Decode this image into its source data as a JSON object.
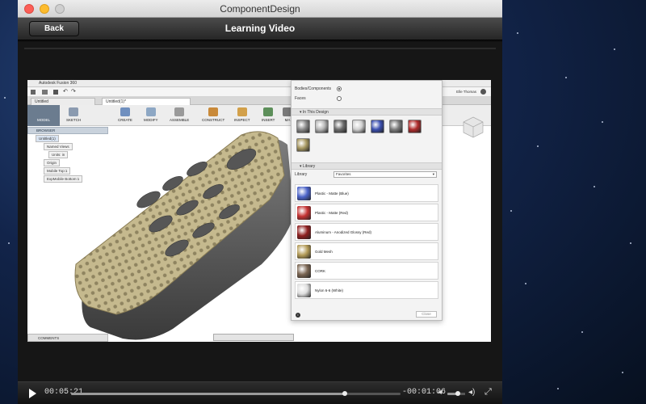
{
  "window": {
    "title": "ComponentDesign",
    "back_label": "Back",
    "page_title": "Learning Video"
  },
  "fusion": {
    "app_title": "Autodesk Fusion 360",
    "tabs": [
      "Untitled",
      "Untitled(1)*"
    ],
    "user": "Elle Thomas",
    "model_label": "MODEL",
    "ribbon": [
      "SKETCH",
      "CREATE",
      "MODIFY",
      "ASSEMBLE",
      "CONSTRUCT",
      "INSPECT",
      "INSERT",
      "MA"
    ],
    "browser": {
      "header": "BROWSER",
      "root": "Untitled(1)",
      "items": [
        "Named Views",
        "Units: in",
        "Origin",
        "Mobile Top:1",
        "ExpMobile Bottom:1"
      ]
    },
    "comments_label": "COMMENTS"
  },
  "materials": {
    "apply_to_label": "Bodies/Components",
    "faces_label": "Faces",
    "in_design_label": "In This Design",
    "design_swatches": [
      "#8a8a8a",
      "#b5b5b5",
      "#6c6c6c",
      "#cfcfcf",
      "#3b4fb0",
      "#7c7c7c",
      "#b02c2c",
      "#a99a63"
    ],
    "library_section": "Library",
    "library_label": "Library",
    "library_value": "Favorites",
    "items": [
      {
        "name": "Plastic - Matte (Blue)",
        "color": "#4b63c8"
      },
      {
        "name": "Plastic - Matte (Red)",
        "color": "#c43232"
      },
      {
        "name": "Aluminum - Anodized Glossy (Red)",
        "color": "#8e1f1f"
      },
      {
        "name": "Gold Mesh",
        "color": "#b39b57"
      },
      {
        "name": "CORK",
        "color": "#7a6552"
      },
      {
        "name": "Nylon 6-6 (White)",
        "color": "#dedede"
      }
    ],
    "close_label": "Close"
  },
  "player": {
    "elapsed": "00:05:21",
    "remaining": "-00:01:06",
    "progress": 0.83,
    "volume": 0.6
  }
}
